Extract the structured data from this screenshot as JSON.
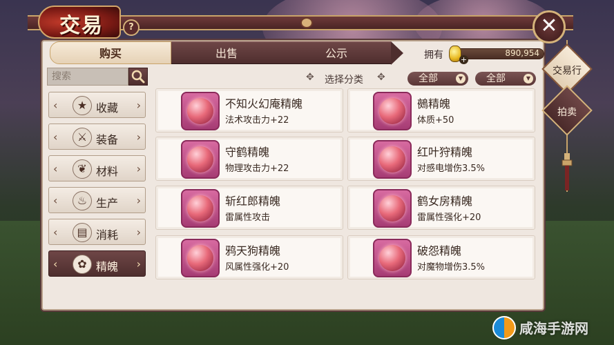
{
  "header": {
    "title": "交易",
    "help_symbol": "?",
    "close_symbol": "✕"
  },
  "tabs": [
    {
      "label": "购买",
      "active": true
    },
    {
      "label": "出售",
      "active": false
    },
    {
      "label": "公示",
      "active": false
    }
  ],
  "currency": {
    "label": "拥有",
    "value": "890,954",
    "plus": "+"
  },
  "search": {
    "placeholder": "搜索"
  },
  "filter": {
    "label": "选择分类",
    "dropdown_1": "全部",
    "dropdown_2": "全部"
  },
  "categories": [
    {
      "label": "收藏",
      "icon": "star-icon",
      "glyph": "★"
    },
    {
      "label": "装备",
      "icon": "sword-icon",
      "glyph": "⚔"
    },
    {
      "label": "材料",
      "icon": "herb-icon",
      "glyph": "❦"
    },
    {
      "label": "生产",
      "icon": "pot-icon",
      "glyph": "♨"
    },
    {
      "label": "消耗",
      "icon": "cards-icon",
      "glyph": "▤"
    },
    {
      "label": "精魄",
      "icon": "flower-icon",
      "glyph": "✿",
      "active": true
    }
  ],
  "items": [
    {
      "name": "不知火幻庵精魄",
      "attr": "法术攻击力+22"
    },
    {
      "name": "鵺精魄",
      "attr": "体质+50"
    },
    {
      "name": "守鹤精魄",
      "attr": "物理攻击力+22"
    },
    {
      "name": "红叶狩精魄",
      "attr": "对感电增伤3.5%"
    },
    {
      "name": "斩红郎精魄",
      "attr": "雷属性攻击"
    },
    {
      "name": "鹤女房精魄",
      "attr": "雷属性强化+20"
    },
    {
      "name": "鸦天狗精魄",
      "attr": "风属性强化+20"
    },
    {
      "name": "破怨精魄",
      "attr": "对魔物增伤3.5%"
    }
  ],
  "side_buttons": {
    "trade": "交易行",
    "auction": "拍卖"
  },
  "watermark": "咸海手游网",
  "colors": {
    "panel_bg": "#efe7e0",
    "tab_dark": "#4e2e2e",
    "accent_gold": "#d4b27a",
    "orb_pink": "#d76aa0"
  }
}
